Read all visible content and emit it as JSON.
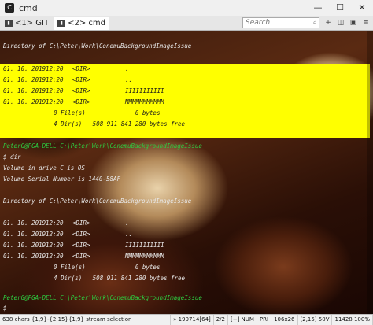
{
  "window": {
    "title": "cmd",
    "icon": "console-app-icon"
  },
  "window_buttons": {
    "minimize": "—",
    "maximize": "☐",
    "close": "✕"
  },
  "tabs": [
    {
      "label": "<1> GIT",
      "icon": "git-tab-icon"
    },
    {
      "label": "<2> cmd",
      "icon": "cmd-tab-icon"
    }
  ],
  "search": {
    "placeholder": "Search"
  },
  "toolbar_icons": [
    "plus-icon",
    "split-icon",
    "lock-icon",
    "menu-icon"
  ],
  "console": {
    "dir_header_1": "Directory of C:\\Peter\\Work\\ConemuBackgroundImageIssue",
    "entries_1": [
      {
        "date": "01. 10. 2019",
        "time": "12:20",
        "type": "<DIR>",
        "name": "."
      },
      {
        "date": "01. 10. 2019",
        "time": "12:20",
        "type": "<DIR>",
        "name": ".."
      },
      {
        "date": "01. 10. 2019",
        "time": "12:20",
        "type": "<DIR>",
        "name": "IIIIIIIIIII"
      },
      {
        "date": "01. 10. 2019",
        "time": "12:20",
        "type": "<DIR>",
        "name": "MMMMMMMMMMM"
      }
    ],
    "files_summary_1": "0 File(s)              0 bytes",
    "dirs_summary_1": "4 Dir(s)   508 911 841 280 bytes free",
    "prompt_1": "PeterG@PGA-DELL C:\\Peter\\Work\\ConemuBackgroundImageIssue",
    "command": "$ dir",
    "volume_line": "Volume in drive C is OS",
    "serial_line": "Volume Serial Number is 1440-58AF",
    "dir_header_2": "Directory of C:\\Peter\\Work\\ConemuBackgroundImageIssue",
    "entries_2": [
      {
        "date": "01. 10. 2019",
        "time": "12:20",
        "type": "<DIR>",
        "name": "."
      },
      {
        "date": "01. 10. 2019",
        "time": "12:20",
        "type": "<DIR>",
        "name": ".."
      },
      {
        "date": "01. 10. 2019",
        "time": "12:20",
        "type": "<DIR>",
        "name": "IIIIIIIIIII"
      },
      {
        "date": "01. 10. 2019",
        "time": "12:20",
        "type": "<DIR>",
        "name": "MMMMMMMMMMM"
      }
    ],
    "files_summary_2": "0 File(s)              0 bytes",
    "dirs_summary_2": "4 Dir(s)   508 911 841 280 bytes free",
    "prompt_2": "PeterG@PGA-DELL C:\\Peter\\Work\\ConemuBackgroundImageIssue",
    "cursor_prompt": "$"
  },
  "status": {
    "selection": "638 chars {1,9}-{2,15}{1,9} stream selection",
    "pos": "» 190714[64]",
    "page": "2/2",
    "insert": "[+] NUM",
    "pri": "PRI",
    "size": "106x26",
    "cursor": "(2,15) 50V",
    "pid": "11428 100%"
  },
  "colors": {
    "highlight": "#ffff00",
    "prompt_green": "#2ecc40",
    "text": "#e8e8e8"
  }
}
